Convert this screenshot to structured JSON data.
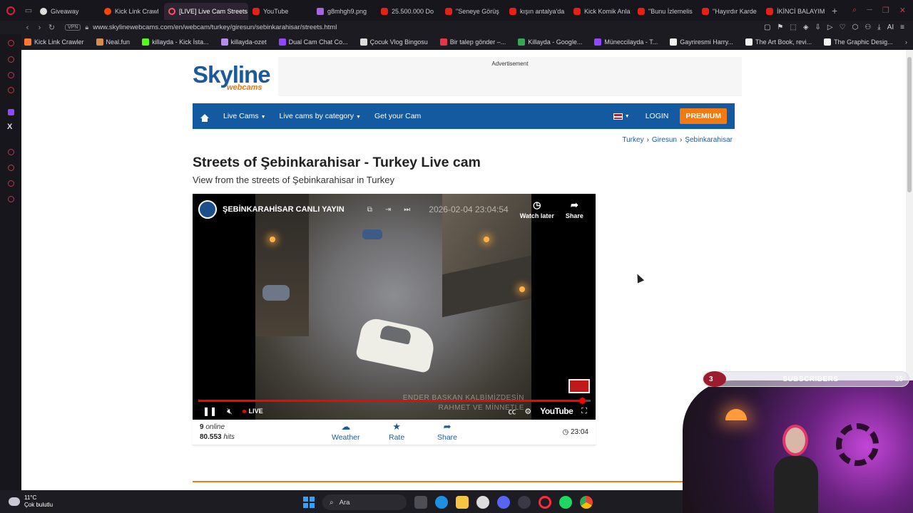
{
  "browser": {
    "tabs": [
      {
        "label": "Giveaway",
        "icon": "face"
      },
      {
        "label": "Kick Link Crawl",
        "icon": "reddit"
      },
      {
        "label": "[LIVE] Live Cam Streets o",
        "icon": "opera",
        "active": true
      },
      {
        "label": "YouTube",
        "icon": "yt"
      },
      {
        "label": "g8mhgh9.png",
        "icon": "img"
      },
      {
        "label": "25.500.000 Do",
        "icon": "yt"
      },
      {
        "label": "\"Seneye Görüş",
        "icon": "yt"
      },
      {
        "label": "kışın antalya'da",
        "icon": "yt"
      },
      {
        "label": "Kick Komik Anla",
        "icon": "yt"
      },
      {
        "label": "\"Bunu İzlemelis",
        "icon": "yt"
      },
      {
        "label": "\"Hayırdır Karde",
        "icon": "yt"
      },
      {
        "label": "İKİNCİ BALAYIM",
        "icon": "yt"
      }
    ],
    "vpn_label": "VPN",
    "url": "www.skylinewebcams.com/en/webcam/turkey/giresun/sebinkarahisar/streets.html",
    "bookmarks": [
      {
        "label": "Kick Link Crawler",
        "color": "#ff7a2f"
      },
      {
        "label": "Neal.fun",
        "color": "#d98b4a"
      },
      {
        "label": "killayda - Kick İsta...",
        "color": "#53fc18"
      },
      {
        "label": "killayda-ozet",
        "color": "#b48cf0"
      },
      {
        "label": "Dual Cam Chat Co...",
        "color": "#9146ff"
      },
      {
        "label": "Çocuk Vlog Bingosu",
        "color": "#dddddd"
      },
      {
        "label": "Bir talep gönder –...",
        "color": "#e8344a"
      },
      {
        "label": "Killayda - Google...",
        "color": "#34a853"
      },
      {
        "label": "Müneccilayda - T...",
        "color": "#9146ff"
      },
      {
        "label": "Gayriresmi Harry...",
        "color": "#f2f2f2"
      },
      {
        "label": "The Art Book, revi...",
        "color": "#f2f2f2"
      },
      {
        "label": "The Graphic Desig...",
        "color": "#f2f2f2"
      }
    ]
  },
  "site": {
    "logo_main": "Skyline",
    "logo_sub": "webcams",
    "ad_label": "Advertisement",
    "nav": {
      "live_cams": "Live Cams",
      "by_category": "Live cams by category",
      "get_cam": "Get your Cam",
      "login": "LOGIN",
      "premium": "PREMIUM"
    },
    "breadcrumb": [
      "Turkey",
      "Giresun",
      "Şebinkarahisar"
    ],
    "title": "Streets of Şebinkarahisar - Turkey Live cam",
    "subtitle": "View from the streets of Şebinkarahisar in Turkey"
  },
  "video": {
    "channel_title": "ŞEBİNKARAHİSAR CANLI YAYIN",
    "timestamp": "2026-02-04 23:04:54",
    "watch_later": "Watch later",
    "share": "Share",
    "overlay_line1": "ENDER BAŞKAN KALBİMİZDESİN",
    "overlay_line2": "RAHMET VE MİNNETLE",
    "live_label": "LIVE",
    "youtube_label": "YouTube",
    "progress": 0.98
  },
  "stats": {
    "online_count": "9",
    "online_label": "online",
    "hits_count": "80.553",
    "hits_label": "hits",
    "weather": "Weather",
    "rate": "Rate",
    "share": "Share",
    "time": "23:04"
  },
  "overlay": {
    "sub_count": "3",
    "sub_label": "SUBSCRIBERS",
    "sub_goal": "25"
  },
  "taskbar": {
    "temperature": "11°C",
    "condition": "Çok bulutlu",
    "search_placeholder": "Ara"
  }
}
